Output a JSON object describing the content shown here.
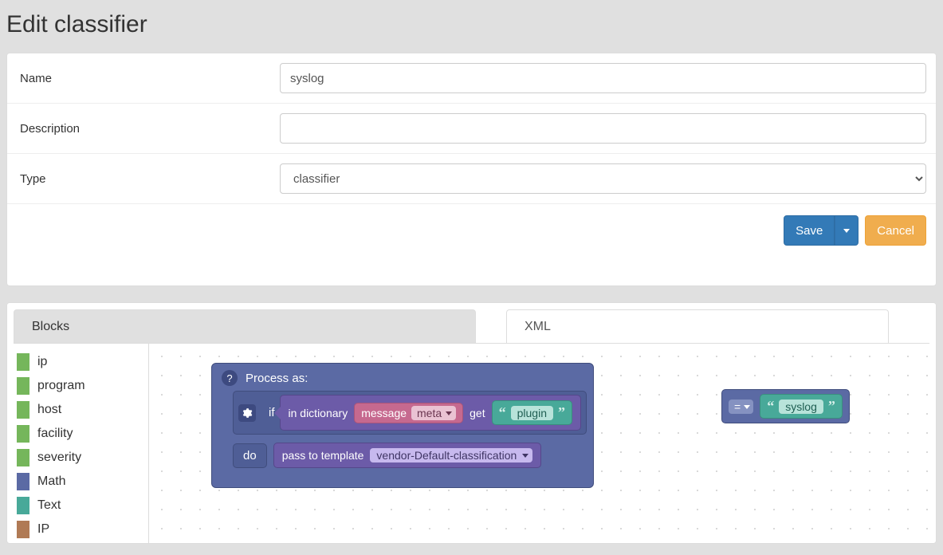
{
  "title": "Edit classifier",
  "form": {
    "name_label": "Name",
    "name_value": "syslog",
    "description_label": "Description",
    "description_value": "",
    "type_label": "Type",
    "type_value": "classifier"
  },
  "actions": {
    "save": "Save",
    "cancel": "Cancel"
  },
  "tabs": {
    "blocks": "Blocks",
    "xml": "XML"
  },
  "palette": [
    {
      "label": "ip",
      "color": "#75b65b"
    },
    {
      "label": "program",
      "color": "#75b65b"
    },
    {
      "label": "host",
      "color": "#75b65b"
    },
    {
      "label": "facility",
      "color": "#75b65b"
    },
    {
      "label": "severity",
      "color": "#75b65b"
    },
    {
      "label": "Math",
      "color": "#5b6aa4"
    },
    {
      "label": "Text",
      "color": "#48a999"
    },
    {
      "label": "IP",
      "color": "#b07a55"
    }
  ],
  "block": {
    "process_as": "Process as:",
    "if": "if",
    "do": "do",
    "in_dictionary": "in dictionary",
    "message": "message",
    "meta": "meta",
    "get": "get",
    "plugin": "plugin",
    "equals": "=",
    "syslog": "syslog",
    "pass_to_template": "pass to template",
    "template_value": "vendor-Default-classification"
  }
}
